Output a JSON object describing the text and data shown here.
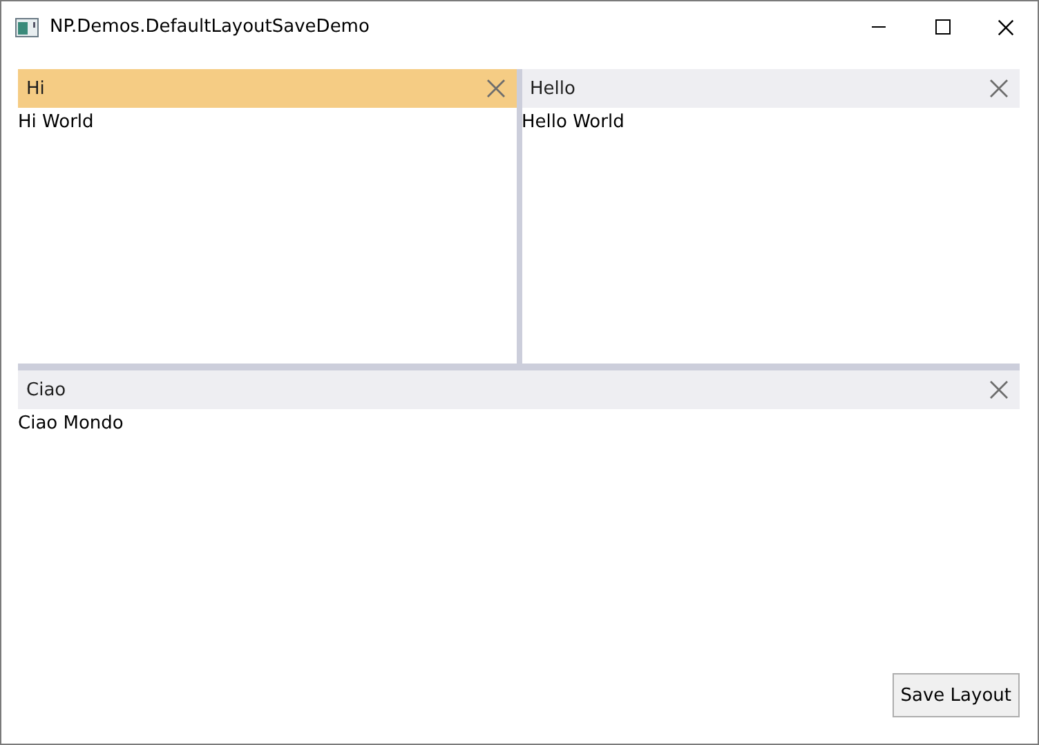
{
  "window": {
    "title": "NP.Demos.DefaultLayoutSaveDemo"
  },
  "top_panes": [
    {
      "title": "Hi",
      "content": "Hi World",
      "selected": true
    },
    {
      "title": "Hello",
      "content": "Hello World",
      "selected": false
    }
  ],
  "bottom_pane": {
    "title": "Ciao",
    "content": "Ciao Mondo",
    "selected": false
  },
  "buttons": [
    "Save Layout"
  ]
}
